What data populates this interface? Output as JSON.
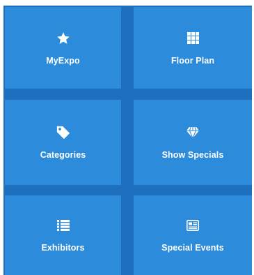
{
  "tiles": [
    {
      "label": "MyExpo",
      "icon": "star-icon"
    },
    {
      "label": "Floor Plan",
      "icon": "grid-icon"
    },
    {
      "label": "Categories",
      "icon": "tag-icon"
    },
    {
      "label": "Show Specials",
      "icon": "diamond-icon"
    },
    {
      "label": "Exhibitors",
      "icon": "list-icon"
    },
    {
      "label": "Special Events",
      "icon": "newspaper-icon"
    }
  ],
  "colors": {
    "tile": "#2d8bdc",
    "gutter": "#1e6fbd",
    "text": "#ffffff"
  }
}
